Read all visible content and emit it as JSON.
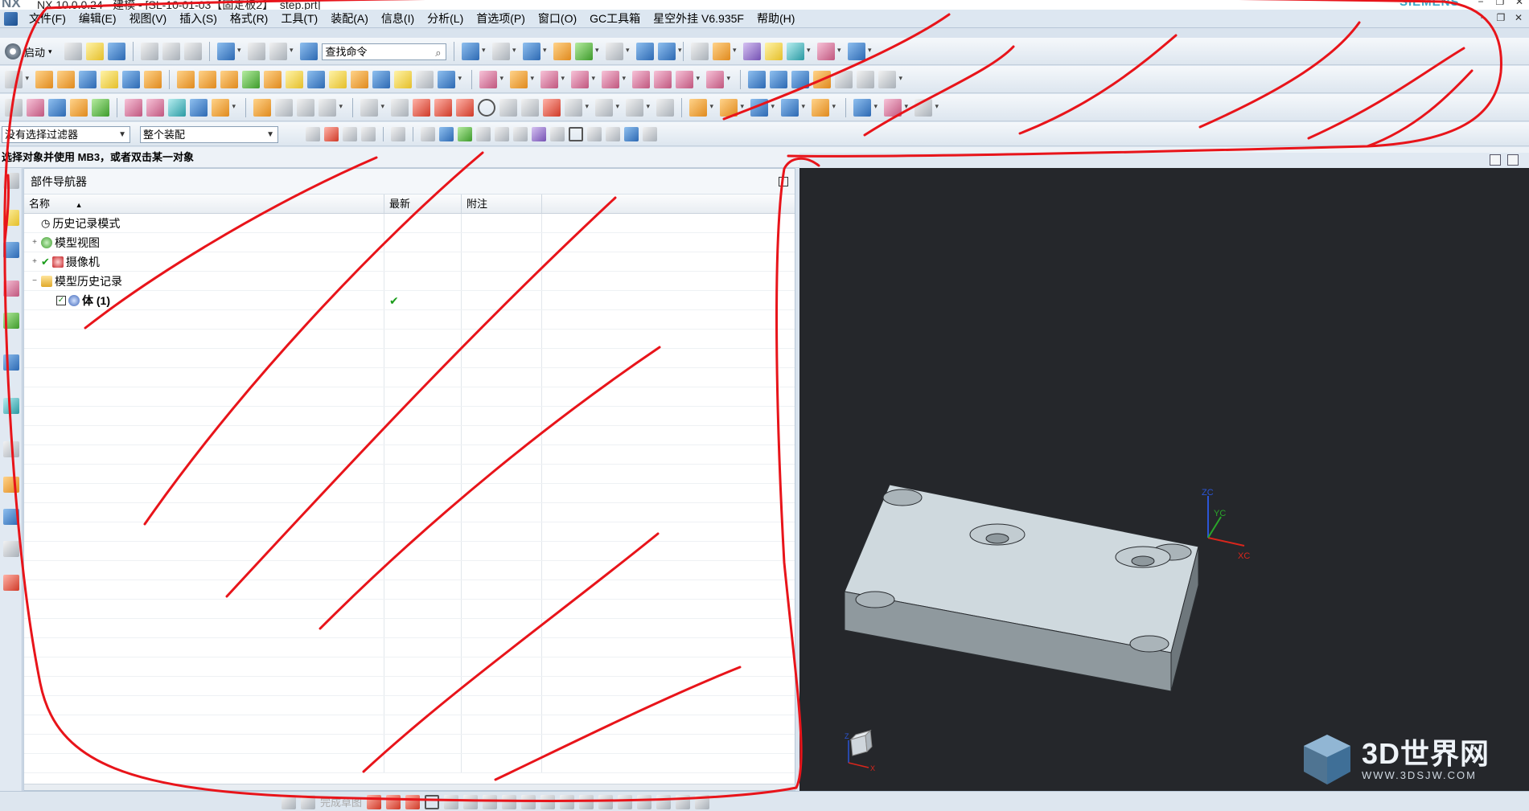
{
  "window": {
    "logo": "NX",
    "title": "NX 10.0.0.24 - 建模 - [SL-10-01-03【固定板2】_step.prt]",
    "brand": "SIEMENS"
  },
  "menubar": {
    "items": [
      "文件(F)",
      "编辑(E)",
      "视图(V)",
      "插入(S)",
      "格式(R)",
      "工具(T)",
      "装配(A)",
      "信息(I)",
      "分析(L)",
      "首选项(P)",
      "窗口(O)",
      "GC工具箱",
      "星空外挂 V6.935F",
      "帮助(H)"
    ]
  },
  "toolbar": {
    "start_label": "启动",
    "search_value": "查找命令"
  },
  "selection_bar": {
    "type_filter": "没有选择过滤器",
    "scope": "整个装配"
  },
  "cue_line": "选择对象并使用 MB3，或者双击某一对象",
  "navigator": {
    "title": "部件导航器",
    "columns": [
      "名称",
      "最新",
      "附注"
    ],
    "rows": [
      {
        "label": "历史记录模式",
        "indent": 1
      },
      {
        "label": "模型视图",
        "indent": 1
      },
      {
        "label": "摄像机",
        "indent": 1
      },
      {
        "label": "模型历史记录",
        "indent": 1
      },
      {
        "label": "体 (1)",
        "indent": 2,
        "latest": "✔"
      }
    ]
  },
  "graphics": {
    "triad_labels": {
      "zc": "ZC",
      "yc": "YC",
      "xc": "XC"
    },
    "view_triad": {
      "z": "Z",
      "x": "X"
    }
  },
  "bottombar": {
    "finish_sketch": "完成草图"
  },
  "watermark": {
    "name": "3D世界网",
    "url": "WWW.3DSJW.COM"
  },
  "colors": {
    "menubar_bg": "#dde7f1",
    "graphics_bg": "#25272b",
    "part_top": "#cfd9de",
    "annotation_red": "#e8141a"
  }
}
